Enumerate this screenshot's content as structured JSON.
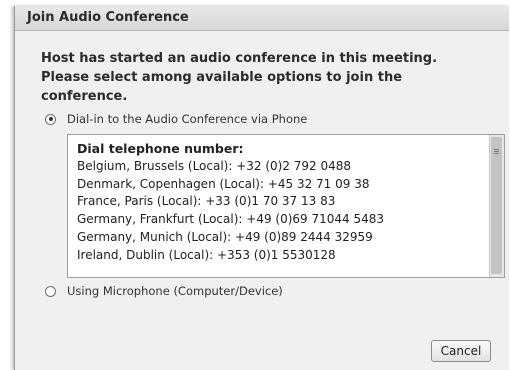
{
  "dialog": {
    "title": "Join Audio Conference",
    "message": "Host has started an audio conference in this meeting. Please select among available options to join the conference.",
    "options": [
      {
        "label": "Dial-in to the Audio Conference via Phone",
        "selected": true
      },
      {
        "label": "Using Microphone (Computer/Device)",
        "selected": false
      }
    ],
    "dial_in": {
      "heading": "Dial telephone number:",
      "numbers": [
        "Belgium, Brussels (Local): +32 (0)2 792 0488",
        "Denmark, Copenhagen (Local): +45 32 71 09 38",
        "France, Paris (Local): +33 (0)1 70 37 13 83",
        "Germany, Frankfurt (Local): +49 (0)69 71044 5483",
        "Germany, Munich (Local): +49 (0)89 2444 32959",
        "Ireland, Dublin (Local): +353 (0)1 5530128"
      ]
    },
    "cancel_label": "Cancel"
  },
  "colors": {
    "dialog_background": "#f0f0f0",
    "titlebar_background": "#d6d6d6",
    "list_background": "#ffffff"
  }
}
